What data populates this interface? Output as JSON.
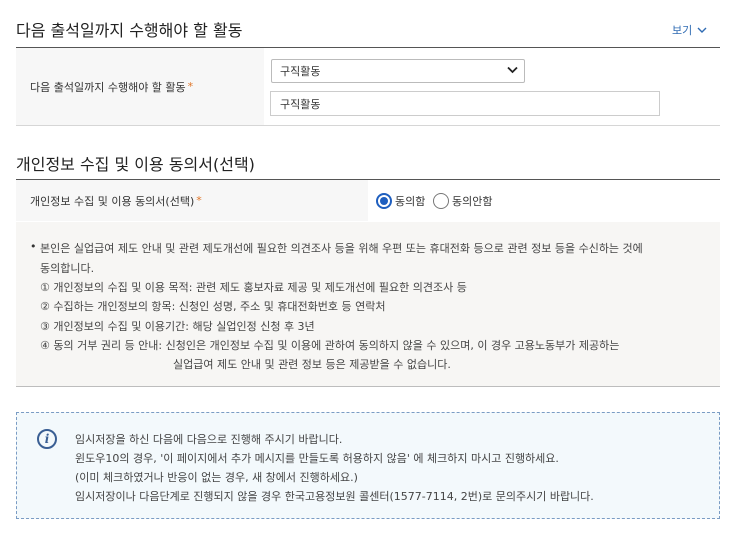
{
  "section1": {
    "title": "다음 출석일까지 수행해야 할 활동",
    "view_toggle": "보기",
    "field_label": "다음 출석일까지 수행해야 할 활동",
    "required_mark": "*",
    "select_value": "구직활동",
    "input_value": "구직활동"
  },
  "section2": {
    "title": "개인정보 수집 및 이용 동의서(선택)",
    "field_label": "개인정보 수집 및 이용 동의서(선택)",
    "required_mark": "*",
    "radio_agree": "동의함",
    "radio_disagree": "동의안함",
    "selected": "agree"
  },
  "notice": {
    "bullet": "•",
    "lines": [
      "본인은 실업급여 제도 안내 및 관련 제도개선에 필요한 의견조사 등을 위해 우편 또는 휴대전화 등으로 관련 정보 등을 수신하는 것에",
      "동의합니다.",
      "① 개인정보의 수집 및 이용 목적: 관련 제도 홍보자료 제공 및 제도개선에 필요한 의견조사 등",
      "② 수집하는 개인정보의 항목: 신청인 성명, 주소 및 휴대전화번호 등 연락처",
      "③ 개인정보의 수집 및 이용기간: 해당 실업인정 신청 후 3년",
      "④ 동의 거부 권리 등 안내: 신청인은 개인정보 수집 및 이용에 관하여 동의하지 않을 수 있으며, 이 경우 고용노동부가 제공하는",
      "실업급여 제도 안내 및 관련 정보 등은 제공받을 수 없습니다."
    ]
  },
  "info": {
    "icon": "info-icon",
    "lines": [
      "임시저장을 하신 다음에 다음으로 진행해 주시기 바랍니다.",
      "윈도우10의 경우, '이 페이지에서 추가 메시지를 만들도록 허용하지 않음' 에 체크하지 마시고 진행하세요.",
      "(이미 체크하였거나 반응이 없는 경우, 새 창에서 진행하세요.)",
      "임시저장이나 다음단계로 진행되지 않을 경우 한국고용정보원 콜센터(1577-7114, 2번)로 문의주시기 바랍니다."
    ]
  },
  "colors": {
    "accent_blue": "#1f5fbf",
    "link_blue": "#2f6bb3",
    "required_orange": "#e0772a",
    "info_border": "#7a9cc4"
  }
}
